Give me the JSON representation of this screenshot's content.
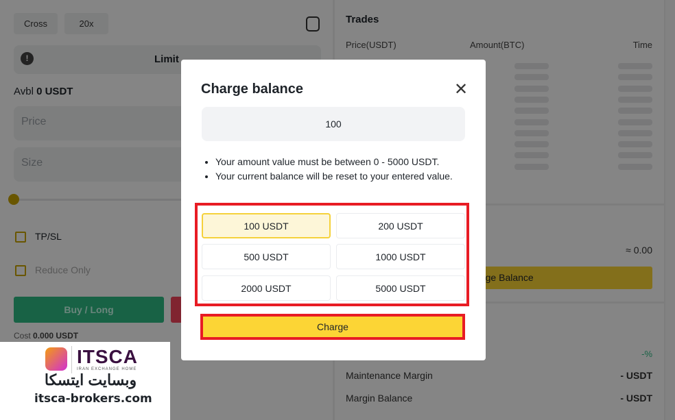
{
  "left": {
    "margin_mode": "Cross",
    "leverage": "20x",
    "order_type": "Limit",
    "avbl_label": "Avbl",
    "avbl_value": "0 USDT",
    "price_placeholder": "Price",
    "size_placeholder": "Size",
    "tpsl": "TP/SL",
    "reduce_only": "Reduce Only",
    "buy_label": "Buy / Long",
    "cost_label": "Cost",
    "cost_value": "0.000 USDT",
    "slider_value_percent": 0
  },
  "trades": {
    "title": "Trades",
    "columns": [
      "Price(USDT)",
      "Amount(BTC)",
      "Time"
    ]
  },
  "account": {
    "approx_value": "≈ 0.00",
    "charge_button": "Charge Balance",
    "pnl_value": "-%",
    "maintenance_label": "Maintenance Margin",
    "maintenance_value": "- USDT",
    "margin_balance_label": "Margin Balance",
    "margin_balance_value": "- USDT"
  },
  "modal": {
    "title": "Charge balance",
    "amount_value": "100",
    "notes": [
      "Your amount value must be between 0 - 5000 USDT.",
      "Your current balance will be reset to your entered value."
    ],
    "options": [
      "100 USDT",
      "200 USDT",
      "500 USDT",
      "1000 USDT",
      "2000 USDT",
      "5000 USDT"
    ],
    "selected": "100 USDT",
    "charge_button": "Charge"
  },
  "watermark": {
    "brand": "ITSCA",
    "tagline": "IRAN EXCHANGE HOME",
    "persian": "وبسایت ایتسکا",
    "url": "itsca-brokers.com"
  },
  "colors": {
    "accent": "#fcd535",
    "buy": "#2ebd85",
    "sell": "#f6465d",
    "highlight": "#e81c24"
  }
}
